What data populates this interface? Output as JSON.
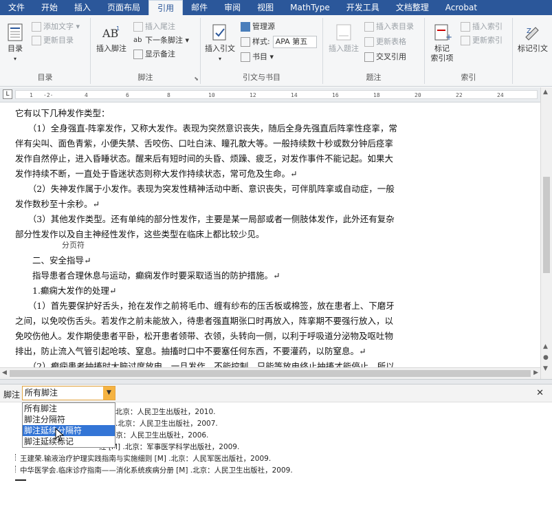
{
  "tabs": [
    "文件",
    "开始",
    "插入",
    "页面布局",
    "引用",
    "邮件",
    "审阅",
    "视图",
    "MathType",
    "开发工具",
    "文档整理",
    "Acrobat"
  ],
  "active_tab": "引用",
  "ribbon": {
    "toc": {
      "big": "目录",
      "add_text": "添加文字",
      "update": "更新目录",
      "group": "目录"
    },
    "footnotes": {
      "insert": "插入脚注",
      "insert_endnote": "插入尾注",
      "next": "下一条脚注",
      "show": "显示备注",
      "group": "脚注"
    },
    "citations": {
      "insert": "插入引文",
      "manage": "管理源",
      "style_label": "样式:",
      "style_value": "APA 第五",
      "bib": "书目",
      "group": "引文与书目"
    },
    "captions": {
      "insert": "插入题注",
      "insert_table": "插入表目录",
      "update_table": "更新表格",
      "cross": "交叉引用",
      "group": "题注"
    },
    "index": {
      "mark": "标记\n索引项",
      "insert": "插入索引",
      "update": "更新索引",
      "group": "索引"
    },
    "toa": {
      "mark": "标记引文"
    }
  },
  "document": {
    "lines": [
      "它有以下几种发作类型：",
      "　　（1）全身强直-阵挛发作，又称大发作。表现为突然意识丧失，随后全身先强直后阵挛性痉挛，常",
      "伴有尖叫、面色青紫，小便失禁、舌咬伤、口吐白沫、瞳孔散大等。一般持续数十秒或数分钟后痉挛",
      "发作自然停止，进入昏睡状态。醒来后有短时间的头昏、烦躁、疲乏，对发作事件不能记起。如果大",
      "发作持续不断，一直处于昏迷状态则称大发作持续状态，常可危及生命。↵",
      "　　（2）失神发作属于小发作。表现为突发性精神活动中断、意识丧失，可伴肌阵挛或自动症，一般",
      "发作数秒至十余秒。↵",
      "　　（3）其他发作类型。还有单纯的部分性发作，主要是某一局部或者一侧肢体发作，此外还有复杂",
      "部分性发作以及自主神经性发作，这些类型在临床上都比较少见。",
      "",
      "　　二、安全指导↵",
      "　　指导患者合理休息与运动，癫痫发作时要采取适当的防护措施。↵",
      "　　1.癫痫大发作的处理↵",
      "　　（1）首先要保护好舌头，抢在发作之前将毛巾、缠有纱布的压舌板或棉签，放在患者上、下磨牙",
      "之间，以免咬伤舌头。若发作之前未能放入，待患者强直期张口时再放入，阵挛期不要强行放入，以",
      "免咬伤他人。发作期使患者平卧，松开患者领带、衣领，头转向一侧，以利于呼吸道分泌物及呕吐物",
      "排出，防止流入气管引起呛咳、窒息。抽搐时口中不要塞任何东西，不要灌药，以防窒息。↵",
      "　　（2）癫痫患者抽搐时大脑过度放电，一旦发作，不能控制，只能等放电终止抽搐才能停止，所以"
    ],
    "page_break": "分页符"
  },
  "footnote_pane": {
    "label": "脚注",
    "selected": "所有脚注",
    "options": [
      "所有脚注",
      "脚注分隔符",
      "脚注延续分隔符",
      "脚注延续标记"
    ],
    "highlighted_index": 2,
    "entries": [
      "[M] .北京：人民卫生出版社，2010.",
      ".6 版.北京：人民卫生出版社，2007.",
      "版.北京：人民卫生出版社，2006.",
      "经 [M] .北京：军事医学科学出版社，2009.",
      "王建荣.输液治疗护理实践指南与实施细则 [M] .北京：人民军医出版社，2009.",
      "中华医学会.临床诊疗指南——消化系统疾病分册 [M] .北京：人民卫生出版社，2009."
    ]
  },
  "colors": {
    "ribbon_blue": "#2b579a",
    "highlight": "#3375d6",
    "dropdown_accent": "#f5b342"
  }
}
